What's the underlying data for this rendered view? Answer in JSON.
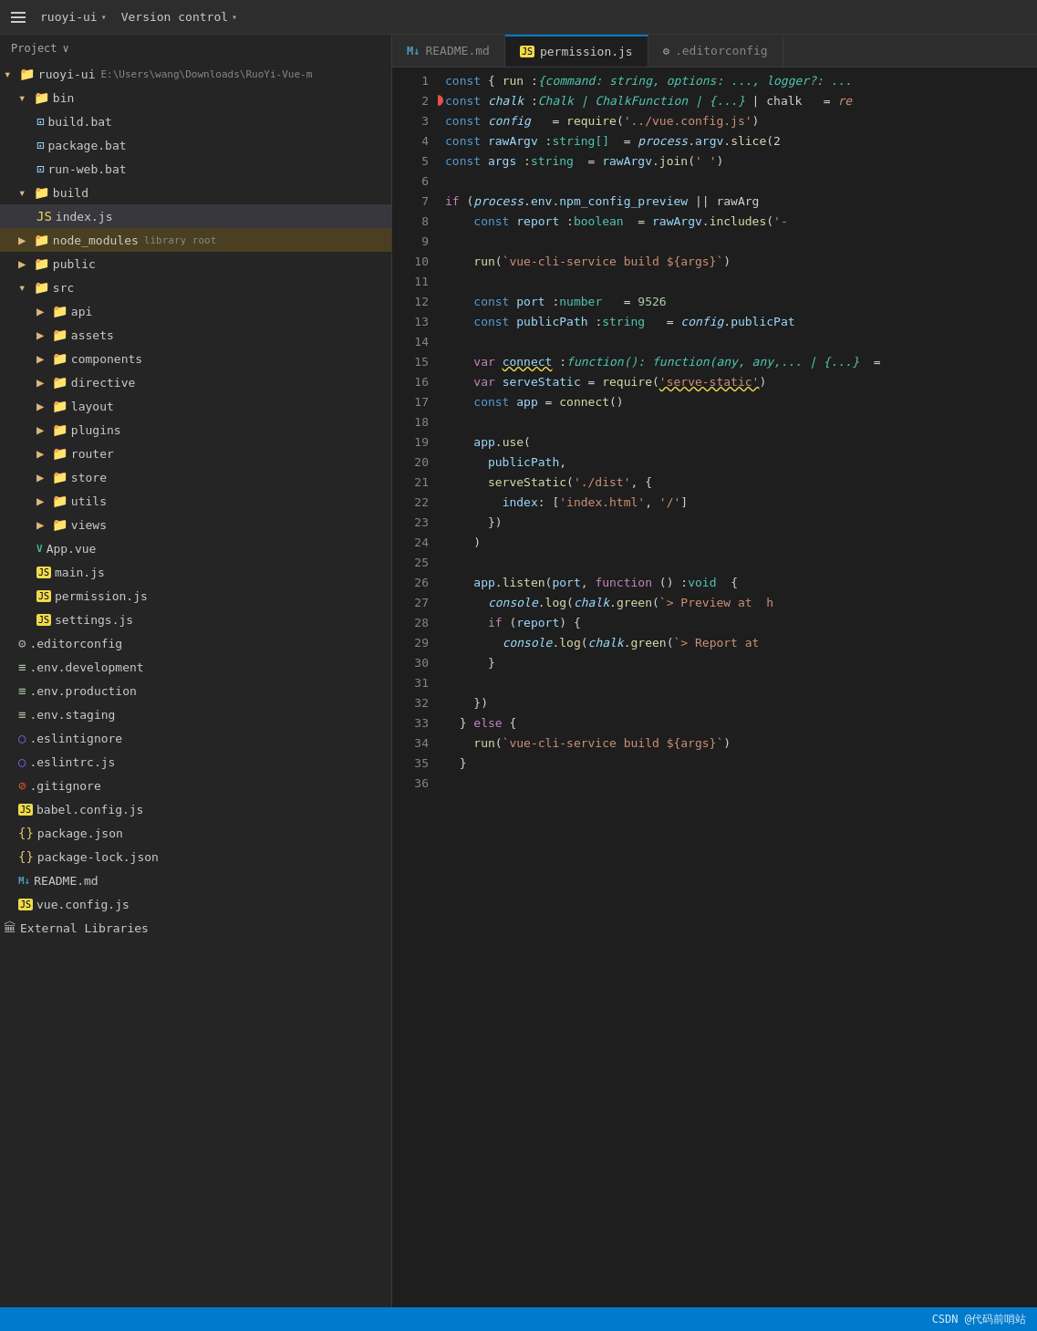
{
  "titlebar": {
    "project_name": "ruoyi-ui",
    "project_chevron": "▾",
    "version_control": "Version control",
    "vc_chevron": "▾"
  },
  "sidebar": {
    "header_label": "Project",
    "header_chevron": "∨",
    "tree": [
      {
        "id": "ruoyi-ui-root",
        "indent": 4,
        "type": "folder-open",
        "label": "ruoyi-ui",
        "badge": "E:\\Users\\wang\\Downloads\\RuoYi-Vue-m",
        "level": 0
      },
      {
        "id": "bin",
        "indent": 20,
        "type": "folder-open",
        "label": "bin",
        "level": 1
      },
      {
        "id": "build.bat",
        "indent": 40,
        "type": "bat",
        "label": "build.bat",
        "level": 2
      },
      {
        "id": "package.bat",
        "indent": 40,
        "type": "bat",
        "label": "package.bat",
        "level": 2
      },
      {
        "id": "run-web.bat",
        "indent": 40,
        "type": "bat",
        "label": "run-web.bat",
        "level": 2
      },
      {
        "id": "build",
        "indent": 20,
        "type": "folder-open",
        "label": "build",
        "level": 1
      },
      {
        "id": "index.js",
        "indent": 40,
        "type": "js",
        "label": "index.js",
        "level": 2
      },
      {
        "id": "node_modules",
        "indent": 20,
        "type": "folder-closed",
        "label": "node_modules",
        "badge": "library root",
        "level": 1,
        "highlighted": true
      },
      {
        "id": "public",
        "indent": 20,
        "type": "folder-closed",
        "label": "public",
        "level": 1
      },
      {
        "id": "src",
        "indent": 20,
        "type": "folder-open",
        "label": "src",
        "level": 1
      },
      {
        "id": "api",
        "indent": 40,
        "type": "folder-closed",
        "label": "api",
        "level": 2
      },
      {
        "id": "assets",
        "indent": 40,
        "type": "folder-closed",
        "label": "assets",
        "level": 2
      },
      {
        "id": "components",
        "indent": 40,
        "type": "folder-closed",
        "label": "components",
        "level": 2
      },
      {
        "id": "directive",
        "indent": 40,
        "type": "folder-closed",
        "label": "directive",
        "level": 2
      },
      {
        "id": "layout",
        "indent": 40,
        "type": "folder-closed",
        "label": "layout",
        "level": 2
      },
      {
        "id": "plugins",
        "indent": 40,
        "type": "folder-closed",
        "label": "plugins",
        "level": 2
      },
      {
        "id": "router",
        "indent": 40,
        "type": "folder-closed",
        "label": "router",
        "level": 2
      },
      {
        "id": "store",
        "indent": 40,
        "type": "folder-closed",
        "label": "store",
        "level": 2
      },
      {
        "id": "utils",
        "indent": 40,
        "type": "folder-closed",
        "label": "utils",
        "level": 2
      },
      {
        "id": "views",
        "indent": 40,
        "type": "folder-closed",
        "label": "views",
        "level": 2
      },
      {
        "id": "App.vue",
        "indent": 40,
        "type": "vue",
        "label": "App.vue",
        "level": 2
      },
      {
        "id": "main.js",
        "indent": 40,
        "type": "js",
        "label": "main.js",
        "level": 2
      },
      {
        "id": "permission.js",
        "indent": 40,
        "type": "js",
        "label": "permission.js",
        "level": 2
      },
      {
        "id": "settings.js",
        "indent": 40,
        "type": "js",
        "label": "settings.js",
        "level": 2
      },
      {
        "id": ".editorconfig",
        "indent": 20,
        "type": "gear",
        "label": ".editorconfig",
        "level": 1
      },
      {
        "id": ".env.development",
        "indent": 20,
        "type": "env",
        "label": ".env.development",
        "level": 1
      },
      {
        "id": ".env.production",
        "indent": 20,
        "type": "env",
        "label": ".env.production",
        "level": 1
      },
      {
        "id": ".env.staging",
        "indent": 20,
        "type": "env",
        "label": ".env.staging",
        "level": 1
      },
      {
        "id": ".eslintignore",
        "indent": 20,
        "type": "eslint",
        "label": ".eslintignore",
        "level": 1
      },
      {
        "id": ".eslintrc.js",
        "indent": 20,
        "type": "eslint",
        "label": ".eslintrc.js",
        "level": 1
      },
      {
        "id": ".gitignore",
        "indent": 20,
        "type": "git",
        "label": ".gitignore",
        "level": 1
      },
      {
        "id": "babel.config.js",
        "indent": 20,
        "type": "js",
        "label": "babel.config.js",
        "level": 1
      },
      {
        "id": "package.json",
        "indent": 20,
        "type": "json",
        "label": "package.json",
        "level": 1
      },
      {
        "id": "package-lock.json",
        "indent": 20,
        "type": "json",
        "label": "package-lock.json",
        "level": 1
      },
      {
        "id": "README.md",
        "indent": 20,
        "type": "md",
        "label": "README.md",
        "level": 1
      },
      {
        "id": "vue.config.js",
        "indent": 20,
        "type": "js",
        "label": "vue.config.js",
        "level": 1
      },
      {
        "id": "external-libraries",
        "indent": 4,
        "type": "folder-closed",
        "label": "External Libraries",
        "level": 0
      }
    ]
  },
  "tabs": [
    {
      "id": "readme",
      "icon": "md",
      "label": "README.md",
      "active": false
    },
    {
      "id": "permission",
      "icon": "js",
      "label": "permission.js",
      "active": true
    },
    {
      "id": "editorconfig",
      "icon": "gear",
      "label": ".editorconfig",
      "active": false
    }
  ],
  "code": {
    "lines": [
      {
        "n": 1,
        "html": "<span class='kw-const'>const</span> <span class='punct'>{</span> <span class='fn'>run</span> <span class='punct'>:</span><span class='type italic'>{command: string, options: ..., logger?: ...</span>"
      },
      {
        "n": 2,
        "html": "<span class='kw-const'>const</span> <span class='blue-light italic'>chalk</span> <span class='punct'>:</span><span class='type italic'>Chalk | ChalkFunction | {...}</span> <span class='white'>| chalk</span>   <span class='op'>=</span> <span class='orange italic'>re</span>",
        "breakpoint": true
      },
      {
        "n": 3,
        "html": "<span class='kw-const'>const</span> <span class='blue-light italic'>config</span> <span class='punct'>:</span>   <span class='op'>=</span> <span class='fn'>require</span><span class='punct'>(</span><span class='str'>'../vue.config.js'</span><span class='punct'>)</span>"
      },
      {
        "n": 4,
        "html": "<span class='kw-const'>const</span> <span class='blue-light'>rawArgv</span> <span class='punct'>:</span><span class='type'>string[]</span>  <span class='op'>=</span> <span class='blue-light italic'>process</span><span class='punct'>.</span><span class='prop'>argv</span><span class='punct'>.</span><span class='fn'>slice</span><span class='punct'>(2</span>"
      },
      {
        "n": 5,
        "html": "<span class='kw-const'>const</span> <span class='blue-light'>args</span> <span class='punct'>:</span><span class='type'>string</span>  <span class='op'>=</span> <span class='blue-light'>rawArgv</span><span class='punct'>.</span><span class='fn'>join</span><span class='punct'>(</span><span class='str'>' '</span><span class='punct'>)</span>"
      },
      {
        "n": 6,
        "html": ""
      },
      {
        "n": 7,
        "html": "<span class='kw-var'>if</span> <span class='punct'>(</span><span class='blue-light italic'>process</span><span class='punct'>.</span><span class='prop'>env</span><span class='punct'>.</span><span class='blue-light'>npm_config_preview</span> <span class='op'>||</span> rawArg"
      },
      {
        "n": 8,
        "html": "    <span class='kw-const'>const</span> <span class='blue-light'>report</span> <span class='punct'>:</span><span class='type'>boolean</span>  <span class='op'>=</span> <span class='blue-light'>rawArgv</span><span class='punct'>.</span><span class='fn'>includes</span><span class='punct'>(</span><span class='str'>'-</span>"
      },
      {
        "n": 9,
        "html": ""
      },
      {
        "n": 10,
        "html": "    <span class='fn'>run</span><span class='punct'>(</span><span class='str'>`vue-cli-service build ${args}`</span><span class='punct'>)</span>"
      },
      {
        "n": 11,
        "html": ""
      },
      {
        "n": 12,
        "html": "    <span class='kw-const'>const</span> <span class='blue-light'>port</span> <span class='punct'>:</span><span class='type'>number</span>   <span class='op'>=</span> <span class='num'>9526</span>"
      },
      {
        "n": 13,
        "html": "    <span class='kw-const'>const</span> <span class='blue-light'>publicPath</span> <span class='punct'>:</span><span class='type'>string</span>   <span class='op'>=</span> <span class='blue-light italic'>config</span><span class='punct'>.</span><span class='prop'>publicPat</span>"
      },
      {
        "n": 14,
        "html": ""
      },
      {
        "n": 15,
        "html": "    <span class='kw-var'>var</span> <span class='blue-light underline'>connect</span> <span class='punct'>:</span><span class='type italic'>function(): function(any, any,... | {...}</span>  <span class='op'>=</span>"
      },
      {
        "n": 16,
        "html": "    <span class='kw-var'>var</span> <span class='blue-light'>serveStatic</span> <span class='op'>=</span> <span class='fn'>require</span><span class='punct'>(</span><span class='str underline'>'serve-static'</span><span class='punct'>)</span>"
      },
      {
        "n": 17,
        "html": "    <span class='kw-const'>const</span> <span class='blue-light'>app</span> <span class='op'>=</span> <span class='fn'>connect</span><span class='punct'>()</span>"
      },
      {
        "n": 18,
        "html": ""
      },
      {
        "n": 19,
        "html": "    <span class='blue-light'>app</span><span class='punct'>.</span><span class='fn'>use</span><span class='punct'>(</span>"
      },
      {
        "n": 20,
        "html": "      <span class='blue-light'>publicPath</span><span class='punct'>,</span>"
      },
      {
        "n": 21,
        "html": "      <span class='fn'>serveStatic</span><span class='punct'>(</span><span class='str'>'./dist'</span><span class='punct'>, {</span>"
      },
      {
        "n": 22,
        "html": "        <span class='blue-light'>index</span><span class='punct'>:</span> <span class='punct'>[</span><span class='str'>'index.html'</span><span class='punct'>,</span> <span class='str'>'/'</span><span class='punct'>]</span>"
      },
      {
        "n": 23,
        "html": "      <span class='punct'>})</span>"
      },
      {
        "n": 24,
        "html": "    <span class='punct'>)</span>"
      },
      {
        "n": 25,
        "html": ""
      },
      {
        "n": 26,
        "html": "    <span class='blue-light'>app</span><span class='punct'>.</span><span class='fn'>listen</span><span class='punct'>(</span><span class='blue-light'>port</span><span class='punct'>,</span> <span class='kw-var'>function</span> <span class='punct'>()</span> <span class='punct'>:</span><span class='type'>void</span>  <span class='punct'>{</span>"
      },
      {
        "n": 27,
        "html": "      <span class='blue-light italic'>console</span><span class='punct'>.</span><span class='fn'>log</span><span class='punct'>(</span><span class='blue-light italic'>chalk</span><span class='punct'>.</span><span class='fn'>green</span><span class='punct'>(</span><span class='str'>`&gt; Preview at  h</span>"
      },
      {
        "n": 28,
        "html": "      <span class='kw-var'>if</span> <span class='punct'>(</span><span class='blue-light'>report</span><span class='punct'>) {</span>"
      },
      {
        "n": 29,
        "html": "        <span class='blue-light italic'>console</span><span class='punct'>.</span><span class='fn'>log</span><span class='punct'>(</span><span class='blue-light italic'>chalk</span><span class='punct'>.</span><span class='fn'>green</span><span class='punct'>(</span><span class='str'>`&gt; Report at </span>"
      },
      {
        "n": 30,
        "html": "      <span class='punct'>}</span>"
      },
      {
        "n": 31,
        "html": ""
      },
      {
        "n": 32,
        "html": "    <span class='punct'>})</span>"
      },
      {
        "n": 33,
        "html": "  <span class='punct'>}</span> <span class='kw-var'>else</span> <span class='punct'>{</span>"
      },
      {
        "n": 34,
        "html": "    <span class='fn'>run</span><span class='punct'>(</span><span class='str'>`vue-cli-service build ${args}`</span><span class='punct'>)</span>"
      },
      {
        "n": 35,
        "html": "  <span class='punct'>}</span>"
      },
      {
        "n": 36,
        "html": ""
      }
    ]
  },
  "statusbar": {
    "watermark": "CSDN @代码前哨站"
  }
}
